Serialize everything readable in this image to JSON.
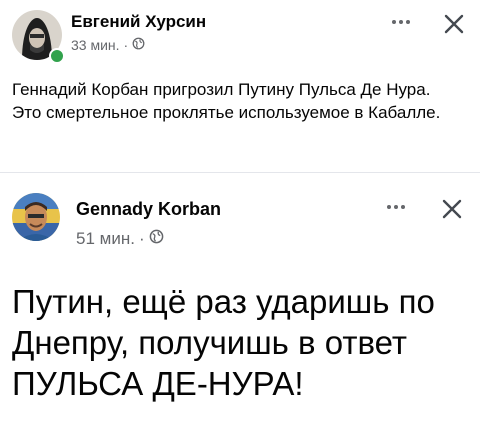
{
  "post1": {
    "author": "Евгений Хурсин",
    "time": "33 мин.",
    "separator": "·",
    "more_icon": "more-dots-icon",
    "close_icon": "close-icon",
    "privacy_icon": "globe-icon",
    "text_line1": "Геннадий Корбан пригрозил Путину Пульса Де Нура.",
    "text_line2": "Это смертельное проклятье используемое в Кабалле."
  },
  "post2": {
    "author": "Gennady Korban",
    "time": "51 мин.",
    "separator": "·",
    "more_icon": "more-dots-icon",
    "close_icon": "close-icon",
    "privacy_icon": "globe-icon",
    "text": "Путин, ещё раз ударишь по Днепру, получишь в ответ ПУЛЬСА ДЕ-НУРА!"
  },
  "colors": {
    "secondary_text": "#65676b",
    "online": "#31a24c",
    "divider": "#e4e6eb"
  }
}
